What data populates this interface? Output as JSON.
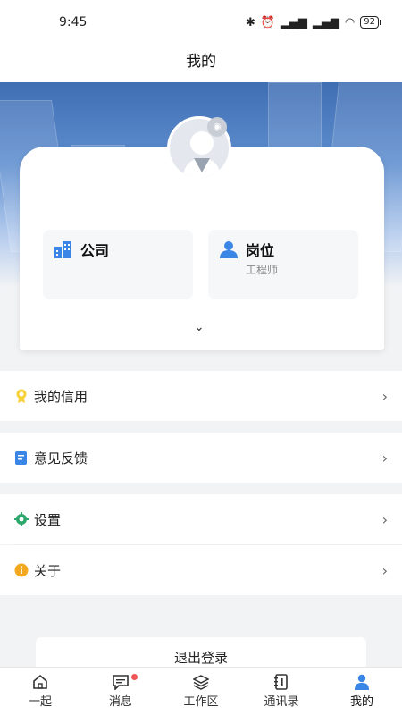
{
  "status": {
    "time": "9:45",
    "battery": "92"
  },
  "header": {
    "title": "我的"
  },
  "profile": {
    "company_label": "公司",
    "company_value": "",
    "position_label": "岗位",
    "position_value": "工程师"
  },
  "menu": {
    "credit": "我的信用",
    "feedback": "意见反馈",
    "settings": "设置",
    "about": "关于"
  },
  "logout_label": "退出登录",
  "tabs": [
    {
      "label": "一起"
    },
    {
      "label": "消息"
    },
    {
      "label": "工作区"
    },
    {
      "label": "通讯录"
    },
    {
      "label": "我的"
    }
  ],
  "colors": {
    "accent": "#3a86e6",
    "hero": "#4a7bc2",
    "badge": "#f05454"
  }
}
